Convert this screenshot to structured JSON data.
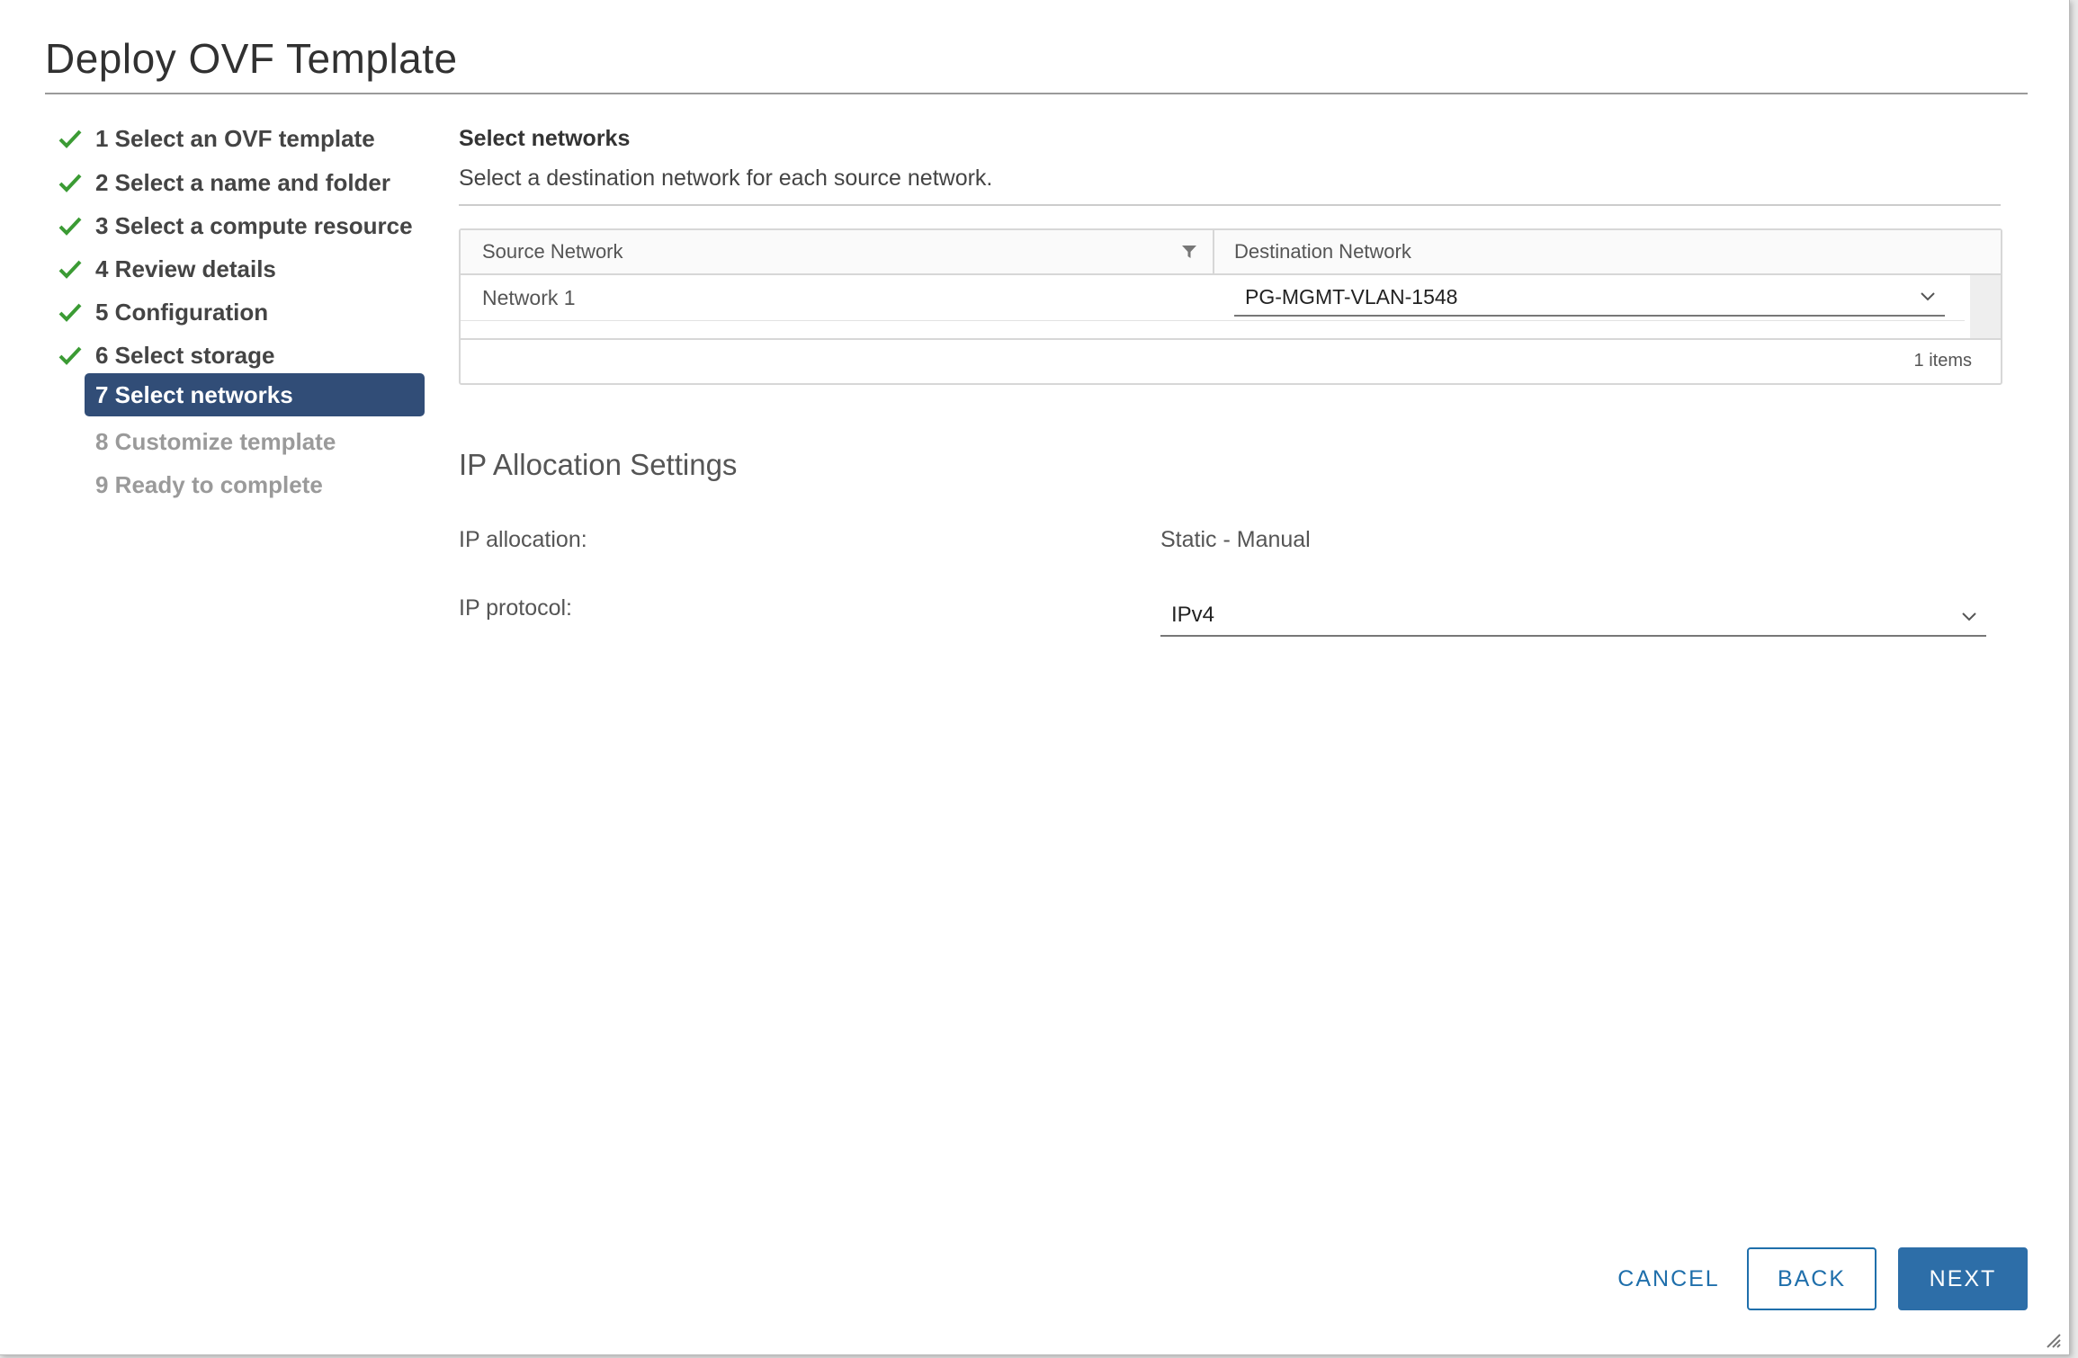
{
  "dialog": {
    "title": "Deploy OVF Template"
  },
  "steps": [
    {
      "label": "1 Select an OVF template",
      "state": "complete"
    },
    {
      "label": "2 Select a name and folder",
      "state": "complete"
    },
    {
      "label": "3 Select a compute resource",
      "state": "complete"
    },
    {
      "label": "4 Review details",
      "state": "complete"
    },
    {
      "label": "5 Configuration",
      "state": "complete"
    },
    {
      "label": "6 Select storage",
      "state": "complete"
    },
    {
      "label": "7 Select networks",
      "state": "active"
    },
    {
      "label": "8 Customize template",
      "state": "disabled"
    },
    {
      "label": "9 Ready to complete",
      "state": "disabled"
    }
  ],
  "networks": {
    "heading": "Select networks",
    "description": "Select a destination network for each source network.",
    "columns": {
      "source": "Source Network",
      "destination": "Destination Network"
    },
    "rows": [
      {
        "source": "Network 1",
        "destination": "PG-MGMT-VLAN-1548"
      }
    ],
    "items_count": "1 items"
  },
  "ip_settings": {
    "heading": "IP Allocation Settings",
    "allocation_label": "IP allocation:",
    "allocation_value": "Static - Manual",
    "protocol_label": "IP protocol:",
    "protocol_value": "IPv4"
  },
  "buttons": {
    "cancel": "CANCEL",
    "back": "BACK",
    "next": "NEXT"
  },
  "colors": {
    "active_step": "#314d77",
    "check": "#3b9b34",
    "primary": "#2d6ea8",
    "link": "#1f6fab"
  },
  "icons": {
    "completed_step": "check-icon",
    "filter": "filter-icon",
    "dropdown": "chevron-down-icon",
    "resize": "resize-grip-icon"
  }
}
